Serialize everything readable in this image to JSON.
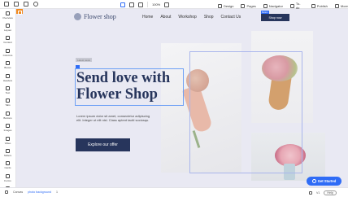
{
  "toolbar": {
    "zoom": "100%",
    "design_label": "Design",
    "pages_label": "Pages",
    "navigator_label": "Navigator",
    "todo_label": "To-do",
    "publish_label": "Publish",
    "more_label": "More"
  },
  "sidebar": {
    "items": [
      {
        "label": "Overview",
        "icon": "overview-icon"
      },
      {
        "label": "Layout",
        "icon": "layout-icon"
      },
      {
        "label": "Content",
        "icon": "content-icon"
      },
      {
        "label": "Columns",
        "icon": "columns-icon"
      },
      {
        "label": "Boxes",
        "icon": "boxes-icon"
      },
      {
        "label": "Headers",
        "icon": "headers-icon"
      },
      {
        "label": "Text",
        "icon": "text-icon"
      },
      {
        "label": "Tabs",
        "icon": "tabs-icon"
      },
      {
        "label": "Buttons",
        "icon": "buttons-icon"
      },
      {
        "label": "Images",
        "icon": "images-icon"
      },
      {
        "label": "Video",
        "icon": "video-icon"
      },
      {
        "label": "Sliders",
        "icon": "sliders-icon"
      },
      {
        "label": "Cards",
        "icon": "cards-icon"
      },
      {
        "label": "Forms",
        "icon": "forms-icon"
      },
      {
        "label": "Marketing",
        "icon": "marketing-icon"
      }
    ]
  },
  "site": {
    "logo_text": "Flower shop",
    "nav": [
      "Home",
      "About",
      "Workshop",
      "Shop",
      "Contact Us"
    ],
    "shop_button": "Shop now",
    "shop_button_tag": "Button",
    "hero_badge": "Latest news",
    "hero_title": "Send love with Flower Shop",
    "hero_paragraph": "Lorem ipsum dolor sit amet, consectetur adipiscing elit. Integer ut elit nisl. Class aptent taciti sociosqu.",
    "cta_label": "Explore our offer"
  },
  "chat": {
    "label": "Get Started"
  },
  "statusbar": {
    "breadcrumb_root": "Canvas",
    "breadcrumb_selected": "photo background",
    "page_label": "1",
    "version": "V1",
    "help_label": "Help"
  },
  "colors": {
    "brand_navy": "#27355c",
    "accent_blue": "#2f6cf6",
    "canvas_bg": "#e9e9f3"
  }
}
